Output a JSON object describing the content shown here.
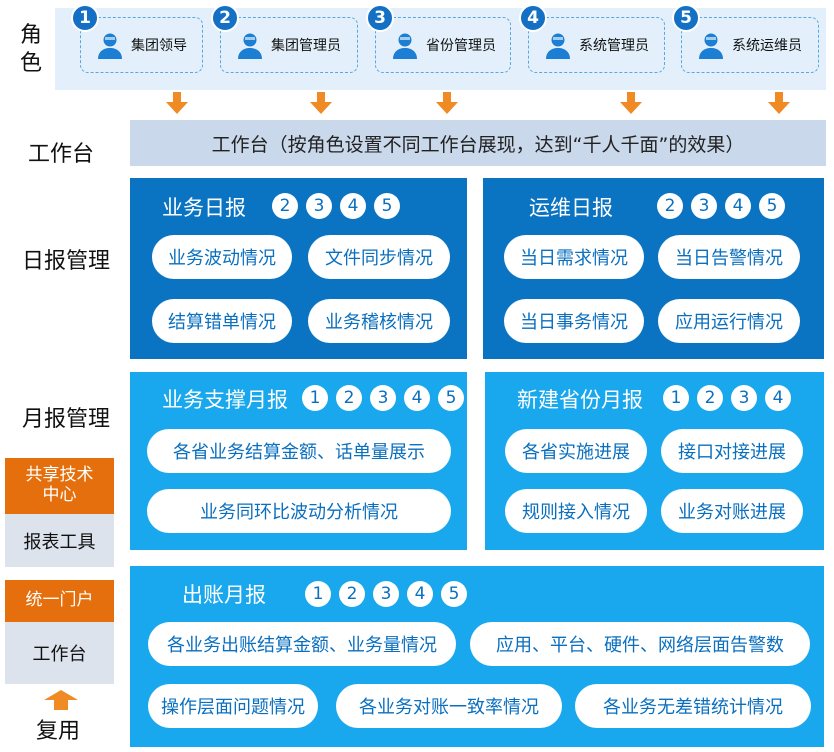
{
  "rows": {
    "roles": [
      "角",
      "色"
    ],
    "workbench": "工作台",
    "daily": "日报管理",
    "monthly": "月报管理",
    "reuse": "复用"
  },
  "roles": [
    {
      "num": "1",
      "label": "集团领导"
    },
    {
      "num": "2",
      "label": "集团管理员"
    },
    {
      "num": "3",
      "label": "省份管理员"
    },
    {
      "num": "4",
      "label": "系统管理员"
    },
    {
      "num": "5",
      "label": "系统运维员"
    }
  ],
  "workbench_bar": "工作台（按角色设置不同工作台展现，达到“千人千面”的效果）",
  "panels": {
    "biz_daily": {
      "title": "业务日报",
      "badges": [
        "2",
        "3",
        "4",
        "5"
      ],
      "items": [
        "业务波动情况",
        "文件同步情况",
        "结算错单情况",
        "业务稽核情况"
      ]
    },
    "ops_daily": {
      "title": "运维日报",
      "badges": [
        "2",
        "3",
        "4",
        "5"
      ],
      "items": [
        "当日需求情况",
        "当日告警情况",
        "当日事务情况",
        "应用运行情况"
      ]
    },
    "support_monthly": {
      "title": "业务支撑月报",
      "badges": [
        "1",
        "2",
        "3",
        "4",
        "5"
      ],
      "items": [
        "各省业务结算金额、话单量展示",
        "业务同环比波动分析情况"
      ]
    },
    "province_monthly": {
      "title": "新建省份月报",
      "badges": [
        "1",
        "2",
        "3",
        "4"
      ],
      "items": [
        "各省实施进展",
        "接口对接进展",
        "规则接入情况",
        "业务对账进展"
      ]
    },
    "billing_monthly": {
      "title": "出账月报",
      "badges": [
        "1",
        "2",
        "3",
        "4",
        "5"
      ],
      "items": [
        "各业务出账结算金额、业务量情况",
        "应用、平台、硬件、网络层面告警数",
        "操作层面问题情况",
        "各业务对账一致率情况",
        "各业务无差错统计情况"
      ]
    }
  },
  "side": {
    "shared": {
      "top": "共享技术中心",
      "bottom": "报表工具"
    },
    "portal": {
      "top": "统一门户",
      "bottom": "工作台"
    }
  },
  "colors": {
    "arrow": "#f08a24",
    "dark_panel": "#0a74c2",
    "light_panel": "#19a8ee",
    "orange_box": "#e56f0c"
  }
}
